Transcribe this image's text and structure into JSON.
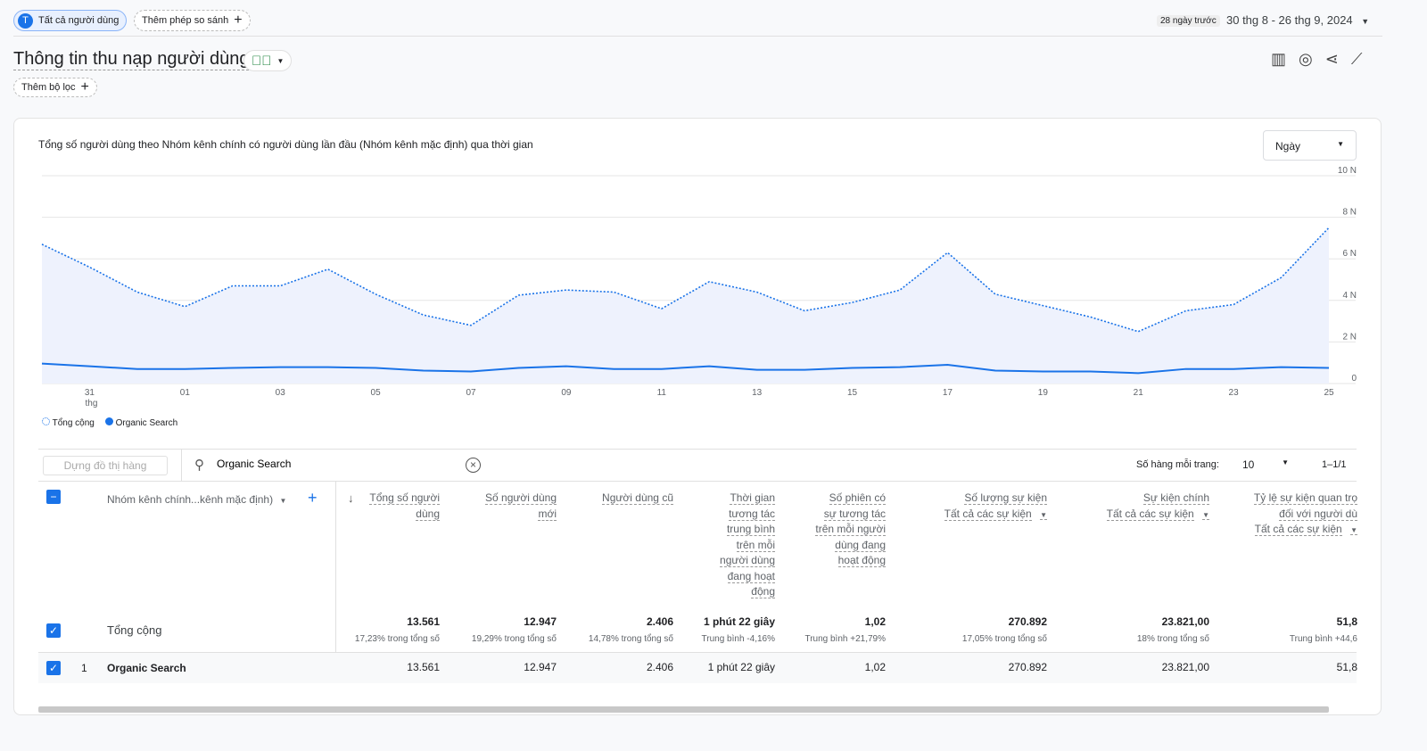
{
  "top": {
    "segment_avatar": "T",
    "segment": "Tất cả người dùng",
    "compare": "Thêm phép so sánh",
    "date_prefix": "28 ngày trước",
    "date_range": "30 thg 8 - 26 thg 9, 2024"
  },
  "header": {
    "title": "Thông tin thu nạp người dùng",
    "add_filter": "Thêm bộ lọc"
  },
  "card": {
    "title": "Tổng số người dùng theo Nhóm kênh chính có người dùng lần đầu (Nhóm kênh mặc định) qua thời gian",
    "granularity": "Ngày"
  },
  "chart_data": {
    "type": "line",
    "x": [
      "2024-08-30",
      "2024-08-31",
      "2024-09-01",
      "2024-09-02",
      "2024-09-03",
      "2024-09-04",
      "2024-09-05",
      "2024-09-06",
      "2024-09-07",
      "2024-09-08",
      "2024-09-09",
      "2024-09-10",
      "2024-09-11",
      "2024-09-12",
      "2024-09-13",
      "2024-09-14",
      "2024-09-15",
      "2024-09-16",
      "2024-09-17",
      "2024-09-18",
      "2024-09-19",
      "2024-09-20",
      "2024-09-21",
      "2024-09-22",
      "2024-09-23",
      "2024-09-24",
      "2024-09-25",
      "2024-09-26"
    ],
    "x_tick_labels": [
      "31",
      "01",
      "03",
      "05",
      "07",
      "09",
      "11",
      "13",
      "15",
      "17",
      "19",
      "21",
      "23",
      "25"
    ],
    "x_tick_sublabel": "thg",
    "y_tick_labels": [
      "0",
      "2 N",
      "4 N",
      "6 N",
      "8 N",
      "10 N"
    ],
    "ylim": [
      0,
      10000
    ],
    "grid": true,
    "legend": "bottom-left",
    "series": [
      {
        "name": "Tổng cộng",
        "style": "dotted",
        "color": "#1a73e8",
        "values": [
          6700,
          5600,
          4400,
          3700,
          4700,
          4700,
          5500,
          4300,
          3300,
          2800,
          4250,
          4500,
          4400,
          3600,
          4900,
          4400,
          3500,
          3900,
          4500,
          6300,
          4300,
          3750,
          3200,
          2500,
          3500,
          3800,
          5100,
          7500
        ]
      },
      {
        "name": "Organic Search",
        "style": "solid",
        "color": "#1a73e8",
        "values": [
          960,
          830,
          700,
          700,
          750,
          790,
          790,
          750,
          620,
          580,
          750,
          830,
          700,
          700,
          830,
          660,
          660,
          750,
          790,
          900,
          620,
          580,
          580,
          500,
          700,
          700,
          790,
          750
        ]
      }
    ]
  },
  "table": {
    "plot_rows": "Dựng đồ thị hàng",
    "search_value": "Organic Search",
    "rows_per_page_label": "Số hàng mỗi trang:",
    "rows_per_page": "10",
    "pagination": "1–1/1",
    "dimension": "Nhóm kênh chính...kênh mặc định)",
    "columns": [
      {
        "lines": [
          "Tổng số người",
          "dùng"
        ]
      },
      {
        "lines": [
          "Số người dùng",
          "mới"
        ]
      },
      {
        "lines": [
          "Người dùng cũ"
        ]
      },
      {
        "lines": [
          "Thời gian",
          "tương tác",
          "trung bình",
          "trên mỗi",
          "người dùng",
          "đang hoạt",
          "động"
        ]
      },
      {
        "lines": [
          "Số phiên có",
          "sự tương tác",
          "trên mỗi người",
          "dùng đang",
          "hoạt động"
        ]
      },
      {
        "lines": [
          "Số lượng sự kiện"
        ],
        "filter": "Tất cả các sự kiện"
      },
      {
        "lines": [
          "Sự kiện chính"
        ],
        "filter": "Tất cả các sự kiện"
      },
      {
        "lines": [
          "Tỷ lệ sự kiện quan trọ",
          "đối với người dù"
        ],
        "filter": "Tất cả các sự kiện"
      }
    ],
    "total": {
      "label": "Tổng cộng",
      "values": [
        "13.561",
        "12.947",
        "2.406",
        "1 phút 22 giây",
        "1,02",
        "270.892",
        "23.821,00",
        "51,8"
      ],
      "subs": [
        "17,23% trong tổng số",
        "19,29% trong tổng số",
        "14,78% trong tổng số",
        "Trung bình -4,16%",
        "Trung bình +21,79%",
        "17,05% trong tổng số",
        "18% trong tổng số",
        "Trung bình +44,6"
      ]
    },
    "rows": [
      {
        "index": "1",
        "label": "Organic Search",
        "values": [
          "13.561",
          "12.947",
          "2.406",
          "1 phút 22 giây",
          "1,02",
          "270.892",
          "23.821,00",
          "51,8"
        ]
      }
    ]
  }
}
